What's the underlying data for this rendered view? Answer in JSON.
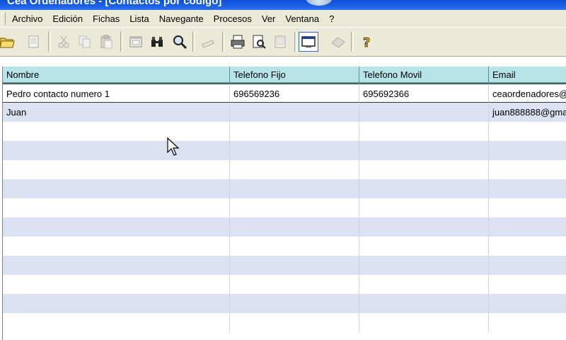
{
  "window": {
    "title": "Cea Ordenadores - [Contactos por código]"
  },
  "menu": [
    "Archivo",
    "Edición",
    "Fichas",
    "Lista",
    "Navegante",
    "Procesos",
    "Ver",
    "Ventana",
    "?"
  ],
  "toolbar": {
    "buttons": [
      "open-folder-icon",
      "edit-record-icon",
      "cut-icon",
      "copy-icon",
      "paste-icon",
      "window-icon",
      "binoculars-icon",
      "magnifier-icon",
      "stamp-icon",
      "printer-icon",
      "print-preview-icon",
      "page-icon",
      "screen-icon",
      "eraser-icon",
      "help-key-icon"
    ]
  },
  "grid": {
    "columns": [
      "Nombre",
      "Telefono Fijo",
      "Telefono Movil",
      "Email"
    ],
    "rows": [
      [
        "Pedro contacto numero 1",
        "696569236",
        "695692366",
        "ceaordenadores@"
      ],
      [
        "Juan",
        "",
        "",
        "juan888888@gma"
      ],
      [
        "",
        "",
        "",
        ""
      ],
      [
        "",
        "",
        "",
        ""
      ],
      [
        "",
        "",
        "",
        ""
      ],
      [
        "",
        "",
        "",
        ""
      ],
      [
        "",
        "",
        "",
        ""
      ],
      [
        "",
        "",
        "",
        ""
      ],
      [
        "",
        "",
        "",
        ""
      ],
      [
        "",
        "",
        "",
        ""
      ],
      [
        "",
        "",
        "",
        ""
      ],
      [
        "",
        "",
        "",
        ""
      ],
      [
        "",
        "",
        "",
        ""
      ]
    ]
  }
}
